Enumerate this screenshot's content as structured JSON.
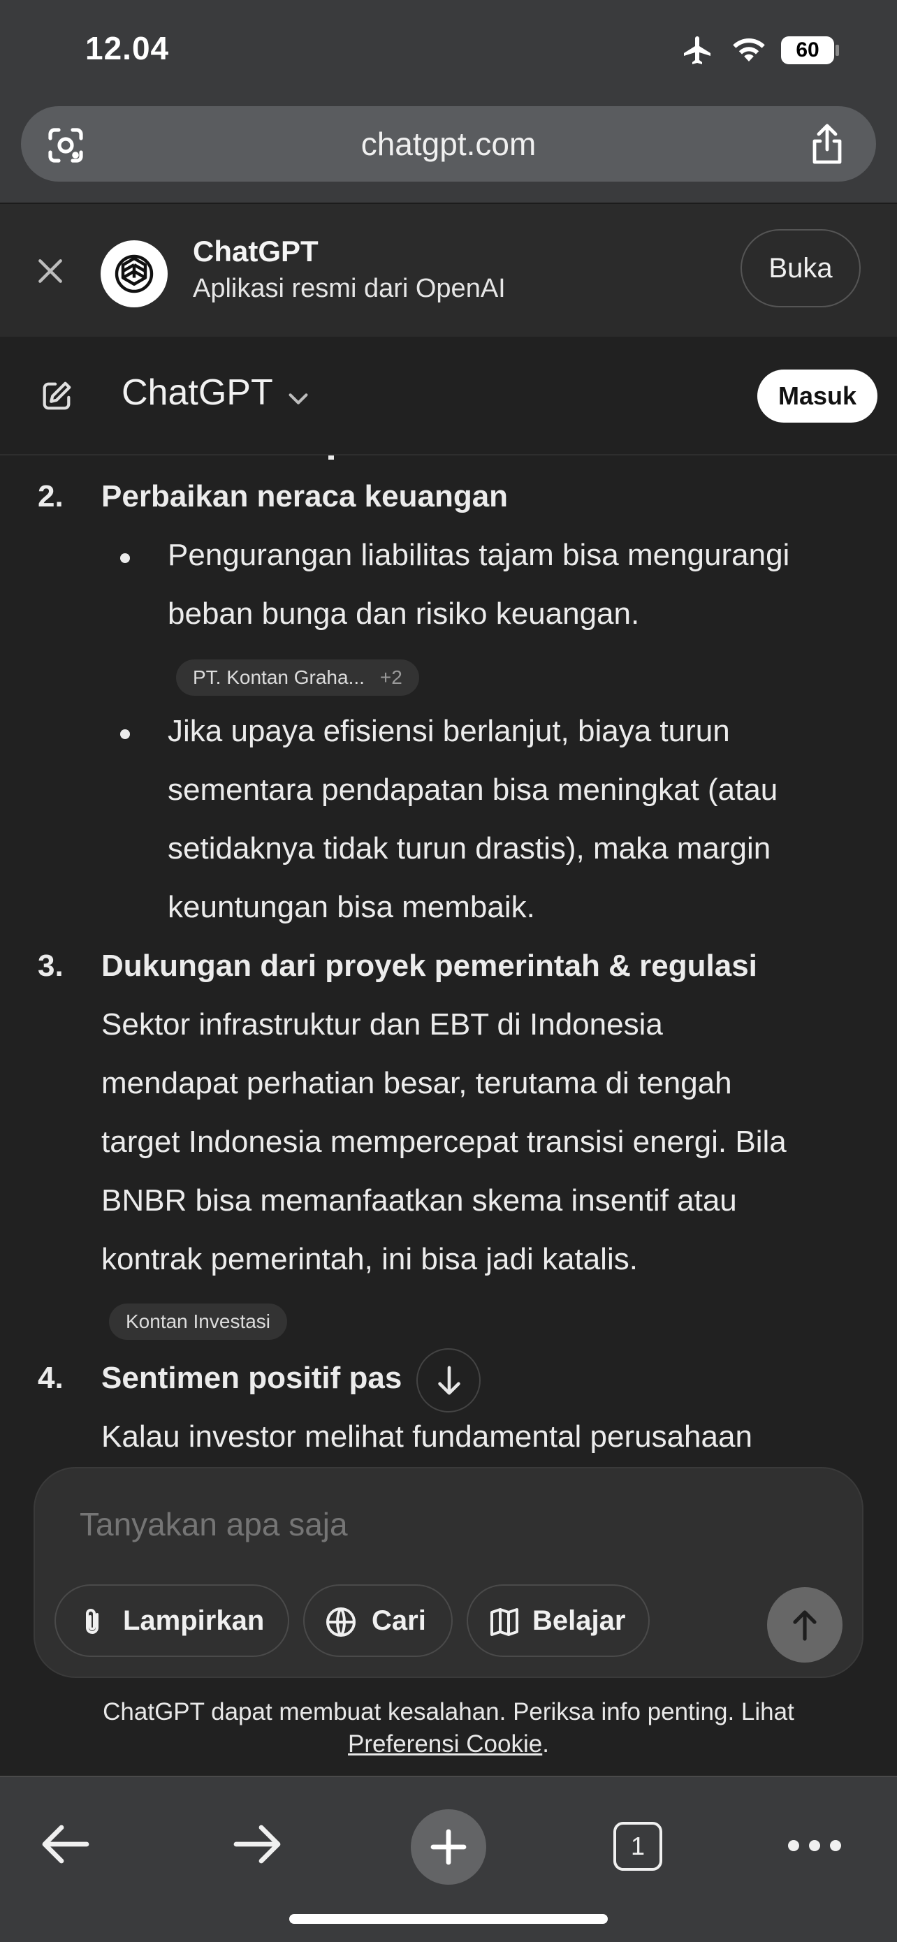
{
  "status_bar": {
    "time": "12.04",
    "battery": "60",
    "icons": [
      "airplane-icon",
      "wifi-icon",
      "battery-icon"
    ]
  },
  "browser": {
    "url": "chatgpt.com",
    "icons": [
      "lens-icon",
      "share-icon"
    ]
  },
  "app_banner": {
    "title": "ChatGPT",
    "subtitle": "Aplikasi resmi dari OpenAI",
    "open_label": "Buka"
  },
  "header": {
    "model": "ChatGPT",
    "login_label": "Masuk"
  },
  "content": {
    "items": [
      {
        "number": "2.",
        "title": "Perbaikan neraca keuangan"
      },
      {
        "number": "3.",
        "title": "Dukungan dari proyek pemerintah & regulasi"
      },
      {
        "number": "4.",
        "title": "Sentimen positif pas"
      }
    ],
    "item2_bullets": [
      [
        "Pengurangan liabilitas tajam bisa mengurangi",
        "beban bunga dan risiko keuangan."
      ],
      [
        "Jika upaya efisiensi berlanjut, biaya turun",
        "sementara pendapatan bisa meningkat (atau",
        "setidaknya tidak turun drastis), maka margin",
        "keuntungan bisa membaik."
      ]
    ],
    "item2_source": {
      "label": "PT. Kontan Graha...",
      "extra": "+2"
    },
    "item3_lines": [
      "Sektor infrastruktur dan EBT di Indonesia",
      "mendapat perhatian besar, terutama di tengah",
      "target Indonesia mempercepat transisi energi. Bila",
      "BNBR bisa memanfaatkan skema insentif atau",
      "kontrak pemerintah, ini bisa jadi katalis."
    ],
    "item3_source": {
      "label": "Kontan Investasi"
    },
    "item4_lines": [
      "Kalau investor melihat fundamental perusahaan"
    ]
  },
  "composer": {
    "placeholder": "Tanyakan apa saja",
    "buttons": [
      {
        "label": "Lampirkan",
        "icon": "paperclip-icon"
      },
      {
        "label": "Cari",
        "icon": "globe-icon"
      },
      {
        "label": "Belajar",
        "icon": "book-icon"
      }
    ]
  },
  "disclaimer": {
    "text": "ChatGPT dapat membuat kesalahan. Periksa info penting. Lihat",
    "link": "Preferensi Cookie",
    "suffix": "."
  },
  "browser_bottom": {
    "tab_count": "1"
  }
}
